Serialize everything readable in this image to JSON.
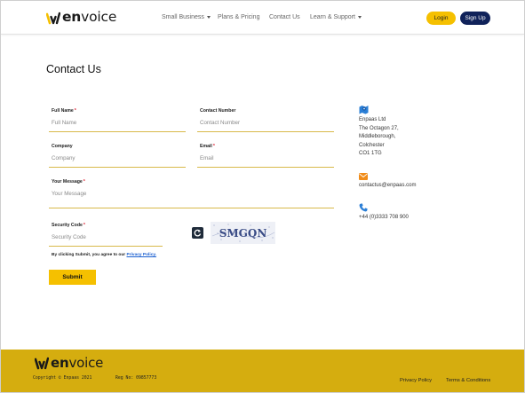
{
  "brand": {
    "logo_text_bold": "en",
    "logo_text_regular": "voice"
  },
  "nav": {
    "small_business": "Small Business",
    "plans_pricing": "Plans & Pricing",
    "contact_us": "Contact Us",
    "learn_support": "Learn & Support",
    "login": "Login",
    "signup": "Sign Up"
  },
  "page": {
    "title": "Contact Us"
  },
  "form": {
    "full_name": {
      "label": "Full Name",
      "required": "*",
      "placeholder": "Full Name",
      "value": ""
    },
    "contact_number": {
      "label": "Contact Number",
      "placeholder": "Contact Number",
      "value": ""
    },
    "company": {
      "label": "Company",
      "placeholder": "Company",
      "value": ""
    },
    "email": {
      "label": "Email",
      "required": "*",
      "placeholder": "Email",
      "value": ""
    },
    "message": {
      "label": "Your Message",
      "required": "*",
      "placeholder": "Your Message",
      "value": ""
    },
    "security_code": {
      "label": "Security Code",
      "required": "*",
      "placeholder": "Security Code",
      "value": ""
    },
    "captcha_text": "SMGQN",
    "consent_text": "By clicking Submit, you agree to our ",
    "privacy_link": "Privacy Policy.",
    "submit_label": "Submit"
  },
  "contact_info": {
    "address": [
      "Enpaas Ltd",
      "The Octagon 27,",
      "Middleborough,",
      "Colchester",
      "CO1 1TG"
    ],
    "email": "contactus@enpaas.com",
    "phone": "+44 (0)3333 708 900"
  },
  "footer": {
    "copyright": "Copyright © Enpaas 2021",
    "reg_no": "Reg No: 09857773",
    "privacy_policy": "Privacy Policy",
    "terms": "Terms & Conditions"
  },
  "colors": {
    "accent_yellow": "#f5c000",
    "navy": "#10225a",
    "footer_bg": "#d5ad0f",
    "icon_blue": "#2b7fd6",
    "icon_orange": "#f08c1a"
  }
}
